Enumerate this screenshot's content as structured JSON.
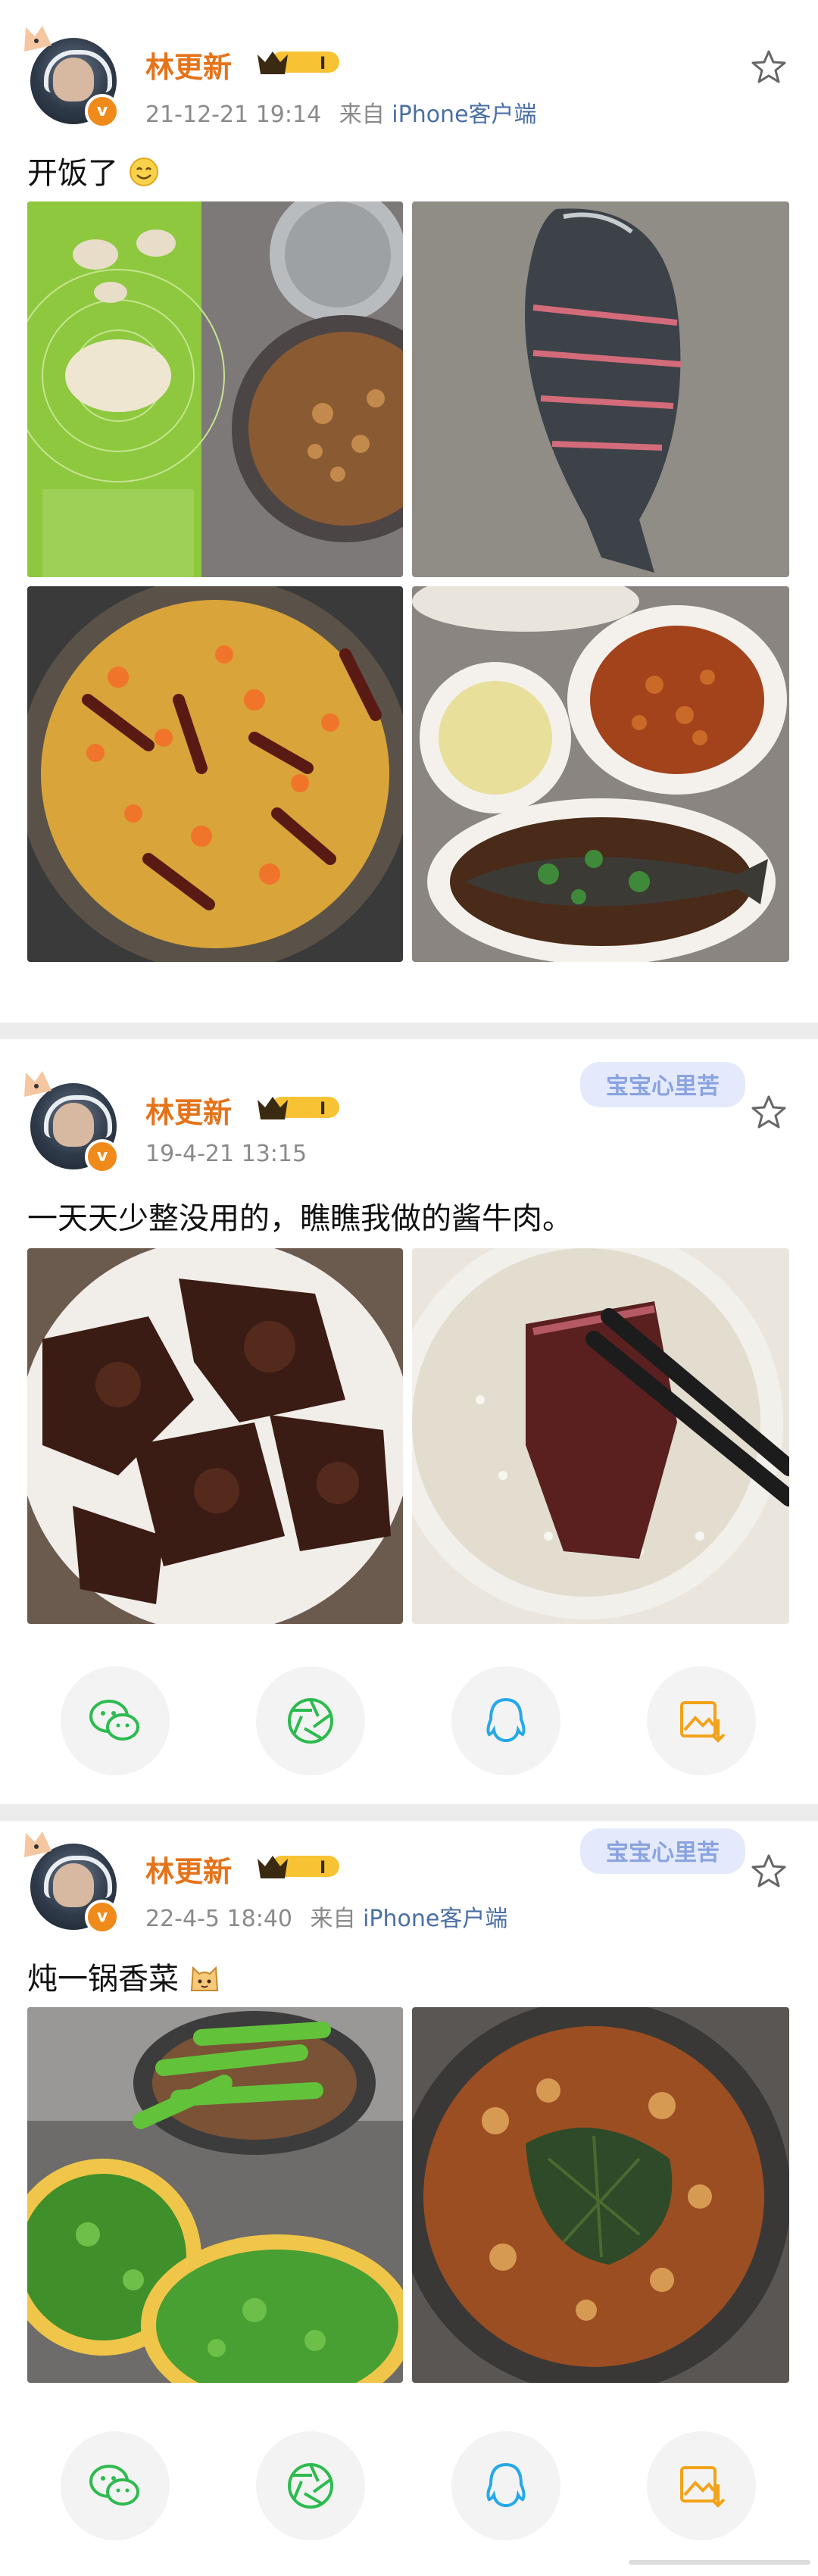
{
  "posts": [
    {
      "username": "林更新",
      "level_badge": "I",
      "meta_time": "21-12-21 19:14",
      "meta_from": "来自",
      "meta_source": "iPhone客户端",
      "text": "开饭了",
      "emoji": "smile-emoji",
      "photos": [
        "dumpling-dough-and-filling",
        "whole-fish-in-pan",
        "spicy-oil-with-chilies",
        "finished-dishes-with-braised-fish"
      ]
    },
    {
      "username": "林更新",
      "level_badge": "I",
      "stamp": "宝宝心里苦",
      "meta_time": "19-4-21 13:15",
      "text": "一天天少整没用的，瞧瞧我做的酱牛肉。",
      "photos": [
        "braised-beef-in-bowl",
        "beef-slice-over-congee"
      ]
    },
    {
      "username": "林更新",
      "level_badge": "I",
      "stamp": "宝宝心里苦",
      "meta_time": "22-4-5 18:40",
      "meta_from": "来自",
      "meta_source": "iPhone客户端",
      "text": "炖一锅香菜",
      "emoji": "cat-emoji",
      "photos": [
        "peppers-and-coriander",
        "stewed-pot"
      ]
    }
  ],
  "share_icons": [
    "wechat-icon",
    "moments-icon",
    "qq-icon",
    "save-image-icon"
  ],
  "colors": {
    "username": "#e5731a",
    "meta": "#8a8a8a",
    "source_link": "#4a6fa5",
    "badge": "#f08a1a",
    "stamp": "#8aa3e0"
  }
}
